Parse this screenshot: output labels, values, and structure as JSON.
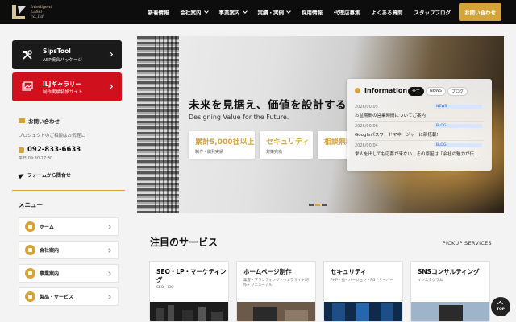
{
  "header": {
    "logo_lines": [
      "Intelligent",
      "Label",
      "co.,ltd."
    ],
    "nav": [
      {
        "label": "新着情報",
        "dropdown": false
      },
      {
        "label": "会社案内",
        "dropdown": true
      },
      {
        "label": "事業案内",
        "dropdown": true
      },
      {
        "label": "実績・実例",
        "dropdown": true
      },
      {
        "label": "採用情報",
        "dropdown": false
      },
      {
        "label": "代理店募集",
        "dropdown": false
      },
      {
        "label": "よくある質問",
        "dropdown": false
      },
      {
        "label": "スタッフブログ",
        "dropdown": false
      }
    ],
    "cta": "お問い合わせ"
  },
  "sidebar": {
    "buttons": [
      {
        "title": "SipsTool",
        "sub": "ASP統合パッケージ",
        "icon": "tools-icon"
      },
      {
        "title": "ILJギャラリー",
        "sub": "制作実績特設サイト",
        "icon": "gallery-icon"
      }
    ],
    "contact": {
      "heading": "お問い合わせ",
      "desc": "プロジェクトのご相談はお気軽に",
      "tel": "092-833-6633",
      "hours": "平日 09:30-17:30",
      "form_link": "フォームから問合せ"
    },
    "menu": {
      "title": "メニュー",
      "items": [
        {
          "label": "ホーム"
        },
        {
          "label": "会社案内"
        },
        {
          "label": "事業案内"
        },
        {
          "label": "製品・サービス"
        }
      ]
    }
  },
  "hero": {
    "title": "未来を見据え、価値を設計する",
    "subtitle": "Designing Value for the Future.",
    "stats": [
      {
        "value": "累計5,000社以上",
        "label": "制作・開発実績"
      },
      {
        "value": "セキュリティ",
        "label": "対策完備"
      },
      {
        "value": "相談無料",
        "label": ""
      }
    ],
    "slides": 3,
    "active_slide": 2
  },
  "info": {
    "title": "Information",
    "tabs": [
      {
        "label": "全て",
        "active": true
      },
      {
        "label": "NEWS",
        "active": false
      },
      {
        "label": "ブログ",
        "active": false
      }
    ],
    "items": [
      {
        "date": "2026/00/05",
        "tag": "NEWS",
        "text": "お盆期間の営業時間についてご案内"
      },
      {
        "date": "2026/00/06",
        "tag": "BLOG",
        "text": "Googleパスワードマネージャーに新搭載!"
      },
      {
        "date": "2026/00/04",
        "tag": "BLOG",
        "text": "求人を出しても応募が来ない…その原因は「会社の魅力が伝..."
      }
    ]
  },
  "services": {
    "title": "注目のサービス",
    "pickup": "PICKUP SERVICES",
    "cards": [
      {
        "title": "SEO・LP・マーケティング",
        "desc": "SEO・IBO"
      },
      {
        "title": "ホームページ制作",
        "desc": "集客・ブランディング・ウェブサイト制作・リニューアル"
      },
      {
        "title": "セキュリティ",
        "desc": "PHP・他・バージョン・PG・サーバー"
      },
      {
        "title": "SNSコンサルティング",
        "desc": "インスタグラム"
      }
    ]
  },
  "top_button": "TOP",
  "colors": {
    "accent": "#d4a43a",
    "header_bg": "#0d0d0d",
    "red": "#d1101d"
  }
}
